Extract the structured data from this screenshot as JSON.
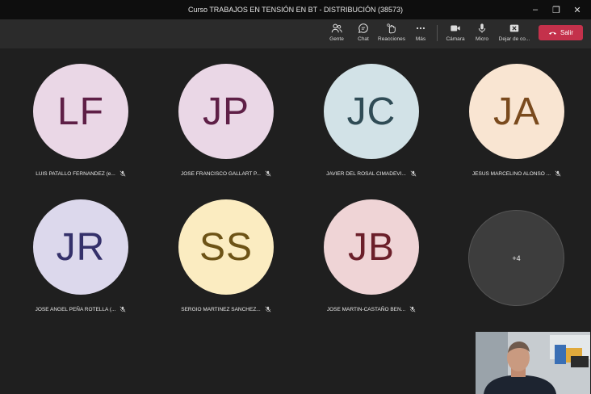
{
  "window": {
    "title": "Curso TRABAJOS EN TENSIÓN EN BT - DISTRIBUCIÓN (38573)"
  },
  "toolbar": {
    "gente": "Gente",
    "chat": "Chat",
    "reacciones": "Reacciones",
    "mas": "Más",
    "camara": "Cámara",
    "micro": "Micro",
    "dejar": "Dejar de co...",
    "salir": "Salir"
  },
  "participants": [
    {
      "initials": "LF",
      "name": "LUIS PATALLO FERNANDEZ (e...",
      "bg": "#ead7e6",
      "fg": "#5e1f46"
    },
    {
      "initials": "JP",
      "name": "JOSE FRANCISCO GALLART P...",
      "bg": "#ead7e6",
      "fg": "#5e1f46"
    },
    {
      "initials": "JC",
      "name": "JAVIER DEL ROSAL CIMADEVI...",
      "bg": "#d2e2e7",
      "fg": "#2f4b55"
    },
    {
      "initials": "JA",
      "name": "JESUS MARCELINO ALONSO ...",
      "bg": "#f9e5d2",
      "fg": "#7a4a1d"
    },
    {
      "initials": "JR",
      "name": "JOSE ANGEL PEÑA ROTELLA (...",
      "bg": "#dcd8ec",
      "fg": "#34306a"
    },
    {
      "initials": "SS",
      "name": "SERGIO MARTINEZ SANCHEZ...",
      "bg": "#fbecc1",
      "fg": "#6d5316"
    },
    {
      "initials": "JB",
      "name": "JOSE MARTIN-CASTAÑO BEN...",
      "bg": "#efd4d6",
      "fg": "#6b1f2a"
    }
  ],
  "overflow": {
    "label": "+4"
  },
  "colors": {
    "leave": "#c4314b",
    "background": "#1f1f1f",
    "toolbar": "#2b2b2b"
  }
}
